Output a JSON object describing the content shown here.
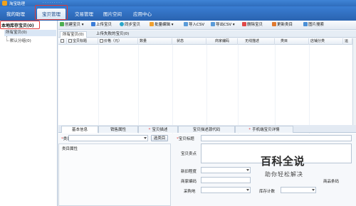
{
  "app": {
    "title": "淘宝助理",
    "account": "· · · · · · · · ·"
  },
  "nav": {
    "tabs": [
      "我的助理",
      "宝贝管理",
      "交易管理",
      "图片空间",
      "应用中心"
    ],
    "active_index": 1
  },
  "sidebar": {
    "header": "本地库存宝贝",
    "header_count": "(0)",
    "subheader": "所有宝贝",
    "subheader_count": "(0)",
    "child": "默认分组",
    "child_count": "(0)"
  },
  "toolbar": {
    "create": "创建宝贝",
    "upload": "上传宝贝",
    "sync": "同步宝贝",
    "batch_edit": "批量编辑",
    "import_csv": "导入CSV",
    "export_csv": "导出CSV",
    "delete": "删除宝贝",
    "update_category": "更新类目",
    "image_search": "图片搜索"
  },
  "subtabs": {
    "all": "所有宝贝",
    "all_count": "(0)",
    "failed": "上传失败的宝贝",
    "failed_count": "(0)"
  },
  "grid": {
    "columns": [
      "宝贝标题",
      "价格（元）",
      "数量",
      "状态",
      "商家编码",
      "无线描述",
      "类目",
      "店铺分类",
      "运"
    ]
  },
  "bottom_tabs": [
    "基本信息",
    "销售属性",
    "宝贝描述",
    "宝贝描述源代码",
    "手机端宝贝详情"
  ],
  "form": {
    "category_label": "类目",
    "select_category_button": "选类目",
    "item_attributes_label": "类目属性",
    "title_label": "宝贝标题",
    "selling_points_label": "宝贝卖点",
    "condition_label": "新旧程度",
    "merchant_code_label": "商家编码",
    "barcode_label": "商品条码",
    "purchase_label": "采购地",
    "stock_label": "库存计数"
  },
  "watermark": {
    "title": "百科全说",
    "subtitle": "助你轻松解决"
  },
  "colors": {
    "accent": "#2f6dbb",
    "highlight": "#e03b3b"
  }
}
